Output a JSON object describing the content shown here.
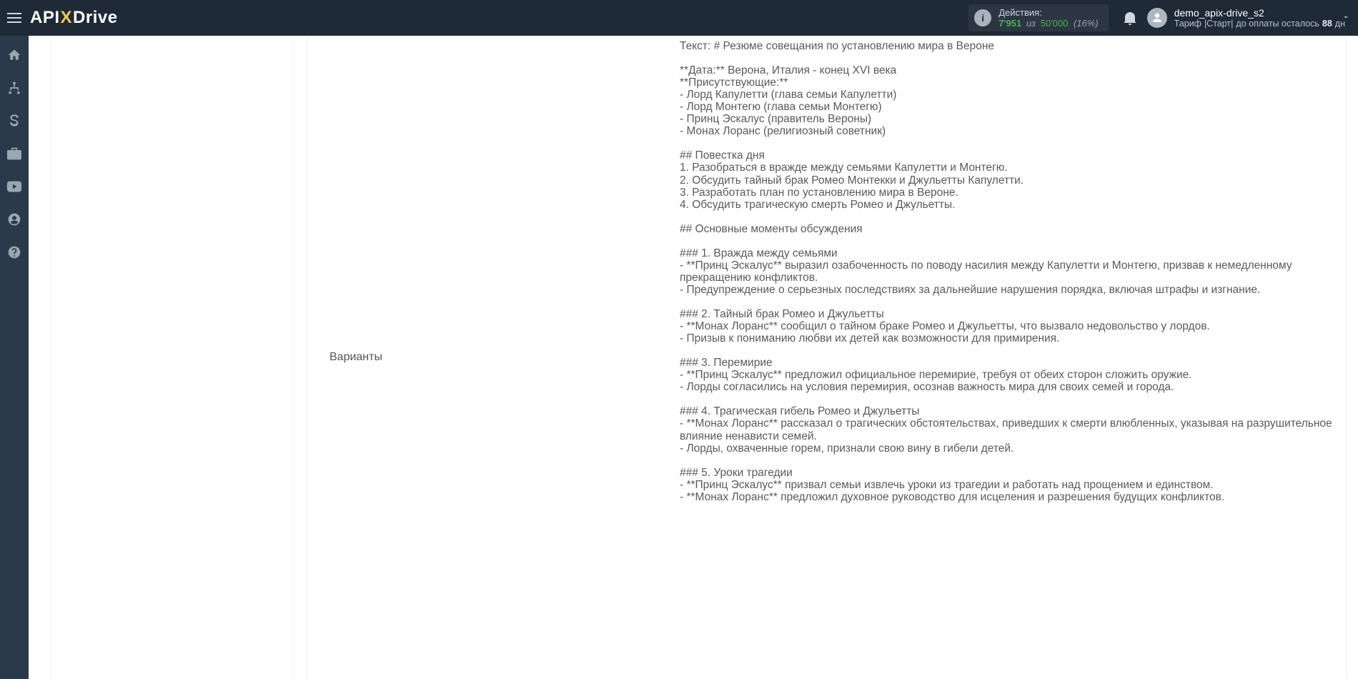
{
  "header": {
    "logo": {
      "part1": "API",
      "part2": "X",
      "part3": "Drive"
    },
    "actions": {
      "title": "Действия:",
      "used": "7'951",
      "of_word": "из",
      "total": "50'000",
      "percent": "(16%)"
    },
    "user": {
      "name": "demo_apix-drive_s2",
      "tariff_label": "Тариф",
      "tariff_plan": "|Старт|",
      "pay_prefix": "до оплаты осталось",
      "pay_days": "88",
      "pay_suffix": "дн"
    }
  },
  "leftrail": {
    "items": [
      "home",
      "sitemap",
      "dollar",
      "briefcase",
      "youtube",
      "user",
      "question"
    ]
  },
  "main": {
    "pane_label": "Варианты",
    "body_text": "Текст: # Резюме совещания по установлению мира в Вероне\n\n**Дата:** Верона, Италия - конец XVI века\n**Присутствующие:**\n- Лорд Капулетти (глава семьи Капулетти)\n- Лорд Монтегю (глава семьи Монтегю)\n- Принц Эскалус (правитель Вероны)\n- Монах Лоранс (религиозный советник)\n\n## Повестка дня\n1. Разобраться в вражде между семьями Капулетти и Монтегю.\n2. Обсудить тайный брак Ромео Монтекки и Джульетты Капулетти.\n3. Разработать план по установлению мира в Вероне.\n4. Обсудить трагическую смерть Ромео и Джульетты.\n\n## Основные моменты обсуждения\n\n### 1. Вражда между семьями\n- **Принц Эскалус** выразил озабоченность по поводу насилия между Капулетти и Монтегю, призвав к немедленному прекращению конфликтов.\n- Предупреждение о серьезных последствиях за дальнейшие нарушения порядка, включая штрафы и изгнание.\n\n### 2. Тайный брак Ромео и Джульетты\n- **Монах Лоранс** сообщил о тайном браке Ромео и Джульетты, что вызвало недовольство у лордов.\n- Призыв к пониманию любви их детей как возможности для примирения.\n\n### 3. Перемирие\n- **Принц Эскалус** предложил официальное перемирие, требуя от обеих сторон сложить оружие.\n- Лорды согласились на условия перемирия, осознав важность мира для своих семей и города.\n\n### 4. Трагическая гибель Ромео и Джульетты\n- **Монах Лоранс** рассказал о трагических обстоятельствах, приведших к смерти влюбленных, указывая на разрушительное влияние ненависти семей.\n- Лорды, охваченные горем, признали свою вину в гибели детей.\n\n### 5. Уроки трагедии\n- **Принц Эскалус** призвал семьи извлечь уроки из трагедии и работать над прощением и единством.\n- **Монах Лоранс** предложил духовное руководство для исцеления и разрешения будущих конфликтов."
  }
}
